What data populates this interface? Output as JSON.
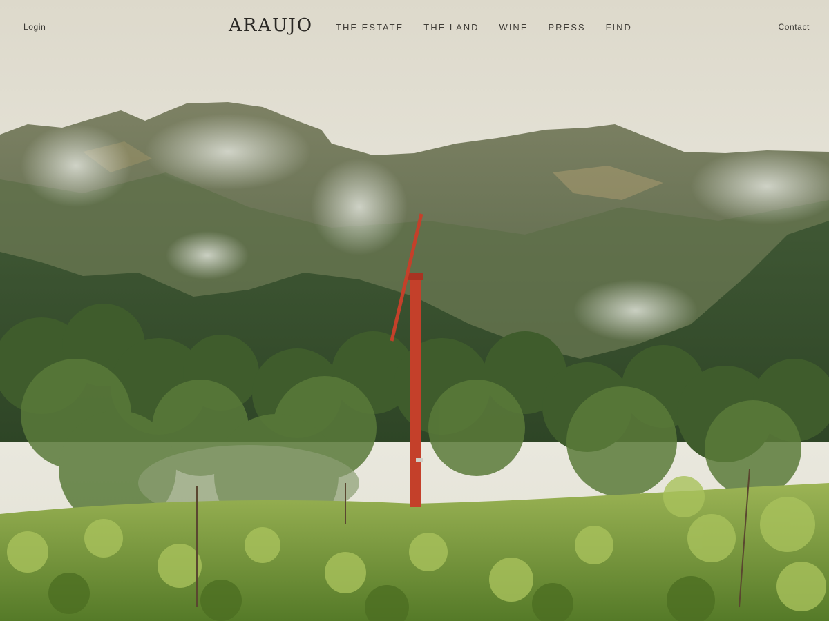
{
  "header": {
    "login_label": "Login",
    "logo_text": "ARAUJO",
    "nav": [
      "THE ESTATE",
      "THE LAND",
      "WINE",
      "PRESS",
      "FIND"
    ],
    "contact_label": "Contact"
  },
  "colors": {
    "sky": "#e8e4d6",
    "mountain": "#6f7b5b",
    "forest": "#3d5430",
    "vineyard": "#8aa845",
    "windmill": "#c4402a",
    "text": "#3c3a35"
  },
  "hero": {
    "icon_names": [
      "windmill",
      "mountains",
      "vineyard"
    ]
  }
}
